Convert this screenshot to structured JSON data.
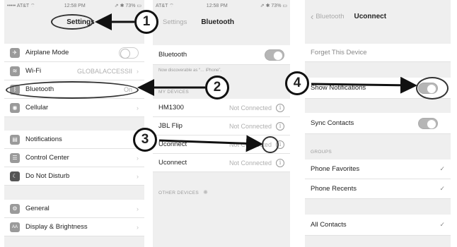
{
  "screen1": {
    "status": {
      "carrier": "••••• AT&T ⌔",
      "time": "12:58 PM",
      "battery": "⇗ ✱ 73% ▭"
    },
    "title": "Settings",
    "airplane": {
      "label": "Airplane Mode"
    },
    "wifi": {
      "label": "Wi-Fi",
      "value": "GLOBALACCESSII"
    },
    "bluetooth": {
      "label": "Bluetooth",
      "value": "On"
    },
    "cellular": {
      "label": "Cellular"
    },
    "notifications": {
      "label": "Notifications"
    },
    "control_center": {
      "label": "Control Center"
    },
    "dnd": {
      "label": "Do Not Disturb"
    },
    "general": {
      "label": "General"
    },
    "display": {
      "label": "Display & Brightness"
    }
  },
  "screen2": {
    "status": {
      "carrier": "AT&T ⌔",
      "time": "12:58 PM",
      "battery": "⇗ ✱ 73% ▭"
    },
    "back": "Settings",
    "title": "Bluetooth",
    "bluetooth_label": "Bluetooth",
    "discoverable_note": "Now discoverable as “… iPhone”.",
    "my_devices_header": "MY DEVICES",
    "devices": [
      {
        "name": "HM1300",
        "status": "Not Connected"
      },
      {
        "name": "JBL Flip",
        "status": "Not Connected"
      },
      {
        "name": "Uconnect",
        "status": "Not Connected"
      },
      {
        "name": "Uconnect",
        "status": "Not Connected"
      }
    ],
    "other_devices_header": "OTHER DEVICES"
  },
  "screen3": {
    "back": "Bluetooth",
    "title": "Uconnect",
    "forget": "Forget This Device",
    "show_notifications": "Show Notifications",
    "sync_contacts": "Sync Contacts",
    "groups_header": "GROUPS",
    "phone_favorites": "Phone Favorites",
    "phone_recents": "Phone Recents",
    "all_contacts": "All Contacts"
  },
  "callouts": [
    "1",
    "2",
    "3",
    "4"
  ]
}
